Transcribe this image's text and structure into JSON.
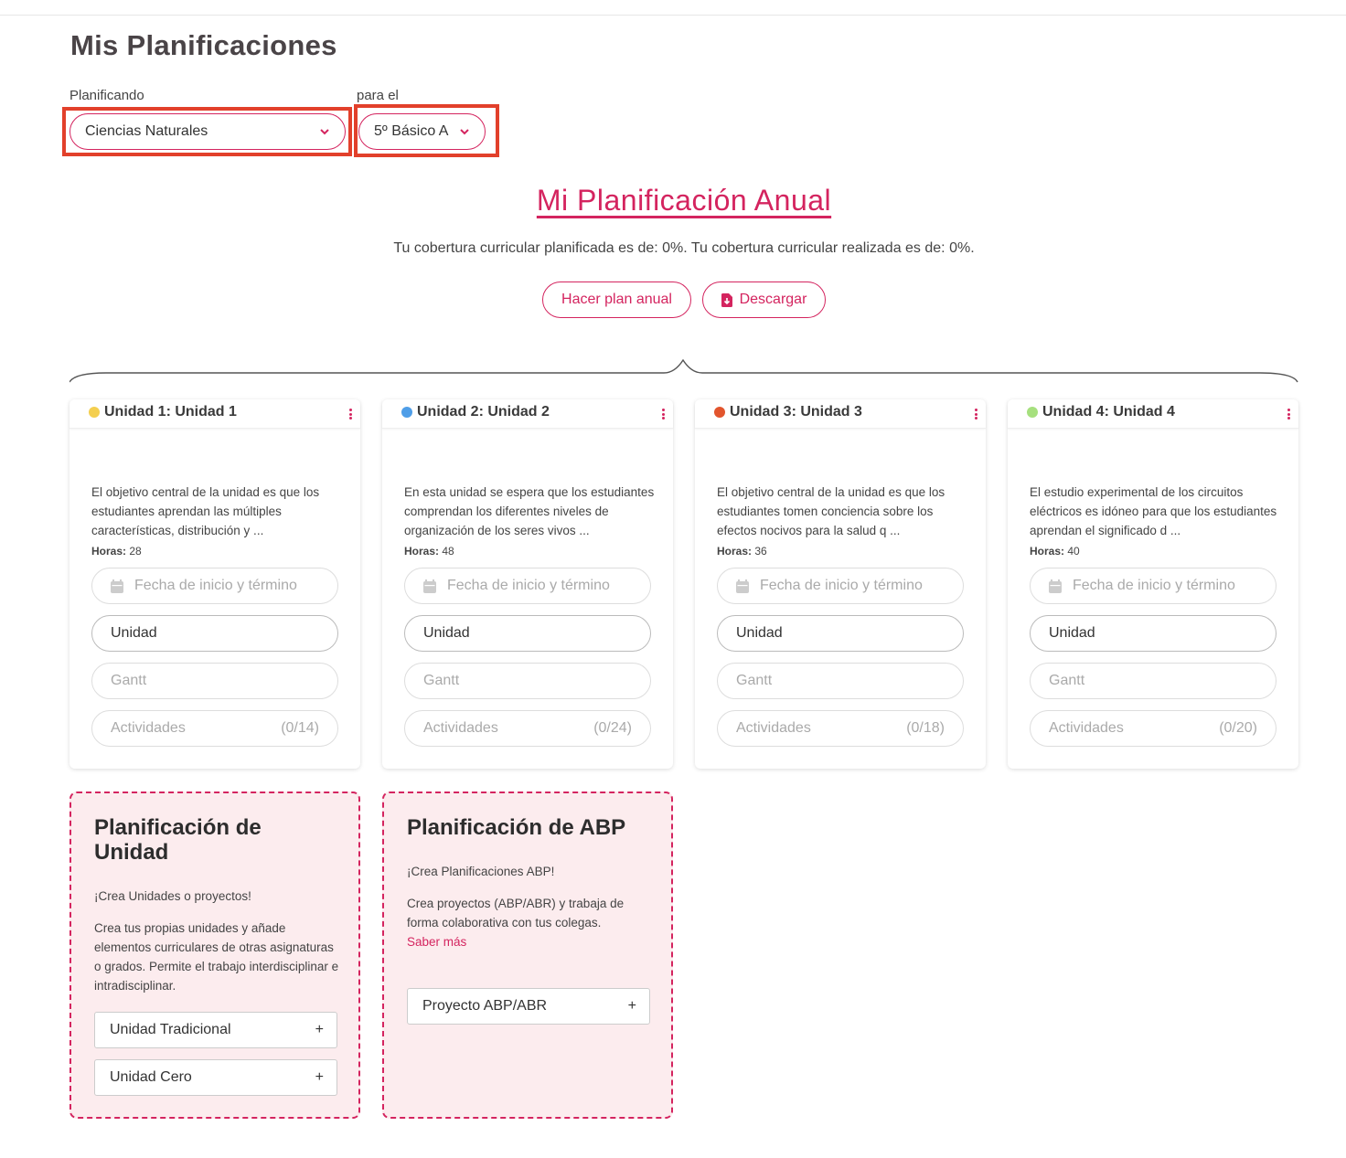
{
  "header": {
    "title": "Mis Planificaciones"
  },
  "filters": {
    "subject_label": "Planificando",
    "subject_value": "Ciencias Naturales",
    "grade_label": "para el",
    "grade_value": "5º Básico A"
  },
  "annual": {
    "link": "Mi Planificación Anual",
    "coverage": "Tu cobertura curricular planificada es de: 0%. Tu cobertura curricular realizada es de: 0%.",
    "make_plan": "Hacer plan anual",
    "download": "Descargar"
  },
  "units": [
    {
      "title": "Unidad 1: Unidad 1",
      "color": "#f4cf4f",
      "desc": "El objetivo central de la unidad es que los estudiantes aprendan las múltiples características, distribución y ...",
      "hours_label": "Horas:",
      "hours": "28",
      "date_placeholder": "Fecha de inicio y término",
      "unit_btn": "Unidad",
      "gantt_btn": "Gantt",
      "activities_label": "Actividades",
      "activities_count": "(0/14)"
    },
    {
      "title": "Unidad 2: Unidad 2",
      "color": "#4f9ee8",
      "desc": "En esta unidad se espera que los estudiantes comprendan los diferentes niveles de organización de los seres vivos ...",
      "hours_label": "Horas:",
      "hours": "48",
      "date_placeholder": "Fecha de inicio y término",
      "unit_btn": "Unidad",
      "gantt_btn": "Gantt",
      "activities_label": "Actividades",
      "activities_count": "(0/24)"
    },
    {
      "title": "Unidad 3: Unidad 3",
      "color": "#e2552d",
      "desc": "El objetivo central de la unidad es que los estudiantes tomen conciencia sobre los efectos nocivos para la salud q ...",
      "hours_label": "Horas:",
      "hours": "36",
      "date_placeholder": "Fecha de inicio y término",
      "unit_btn": "Unidad",
      "gantt_btn": "Gantt",
      "activities_label": "Actividades",
      "activities_count": "(0/18)"
    },
    {
      "title": "Unidad 4: Unidad 4",
      "color": "#a6e07e",
      "desc": "El estudio experimental de los circuitos eléctricos es idóneo para que los estudiantes aprendan el significado d ...",
      "hours_label": "Horas:",
      "hours": "40",
      "date_placeholder": "Fecha de inicio y término",
      "unit_btn": "Unidad",
      "gantt_btn": "Gantt",
      "activities_label": "Actividades",
      "activities_count": "(0/20)"
    }
  ],
  "unit_planning": {
    "title": "Planificación de Unidad",
    "subtitle": "¡Crea Unidades o proyectos!",
    "body": "Crea tus propias unidades y añade elementos curriculares de otras asignaturas o grados. Permite el trabajo interdisciplinar e intradisciplinar.",
    "btn_traditional": "Unidad Tradicional",
    "btn_zero": "Unidad Cero",
    "plus": "+"
  },
  "abp_planning": {
    "title": "Planificación de ABP",
    "subtitle": "¡Crea Planificaciones ABP!",
    "body": "Crea proyectos (ABP/ABR) y trabaja de forma colaborativa con tus colegas.",
    "link": "Saber más",
    "btn_project": "Proyecto ABP/ABR",
    "plus": "+"
  }
}
